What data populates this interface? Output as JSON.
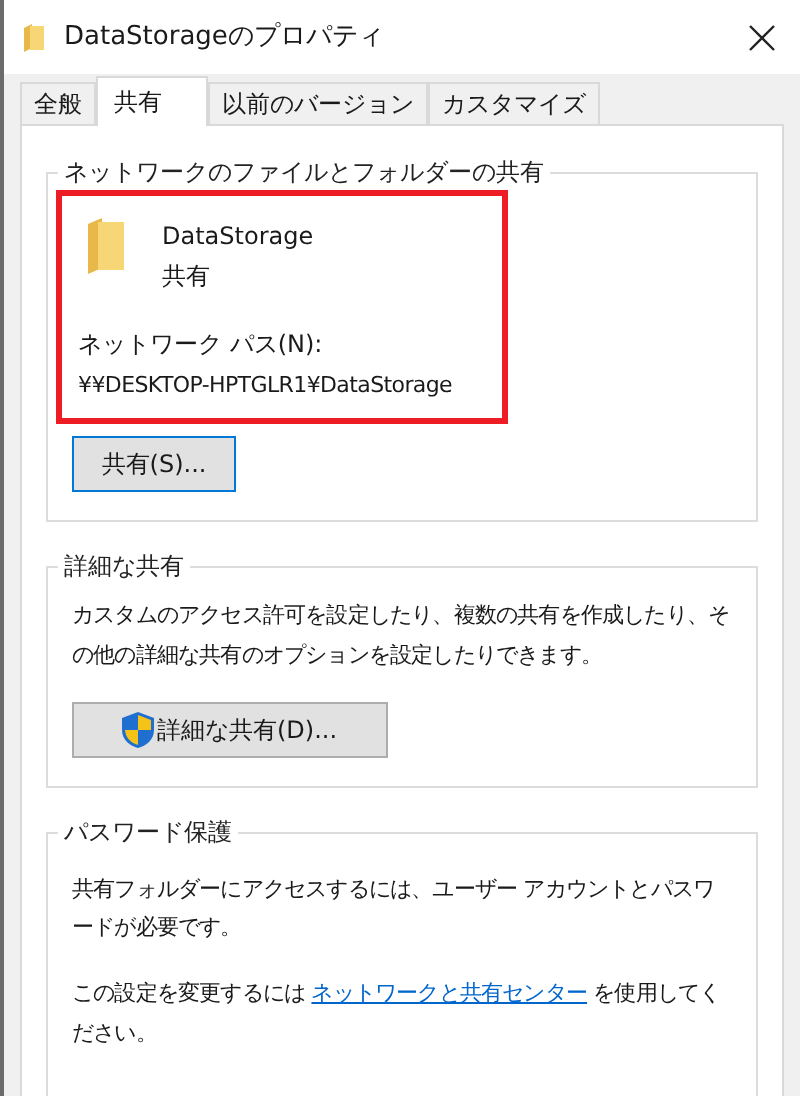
{
  "window": {
    "title": "DataStorageのプロパティ"
  },
  "tabs": [
    {
      "label": "全般",
      "selected": false
    },
    {
      "label": "共有",
      "selected": true
    },
    {
      "label": "以前のバージョン",
      "selected": false
    },
    {
      "label": "カスタマイズ",
      "selected": false
    }
  ],
  "network_sharing": {
    "legend": "ネットワークのファイルとフォルダーの共有",
    "highlighted": true,
    "folder_name": "DataStorage",
    "status": "共有",
    "path_label": "ネットワーク パス(N):",
    "path": "¥¥DESKTOP-HPTGLR1¥DataStorage",
    "button": "共有(S)..."
  },
  "advanced_sharing": {
    "legend": "詳細な共有",
    "description": "カスタムのアクセス許可を設定したり、複数の共有を作成したり、その他の詳細な共有のオプションを設定したりできます。",
    "button": "詳細な共有(D)..."
  },
  "password_protection": {
    "legend": "パスワード保護",
    "description": "共有フォルダーにアクセスするには、ユーザー アカウントとパスワードが必要です。",
    "note_before": "この設定を変更するには",
    "link": "ネットワークと共有センター",
    "note_after": "を使用してください。"
  }
}
